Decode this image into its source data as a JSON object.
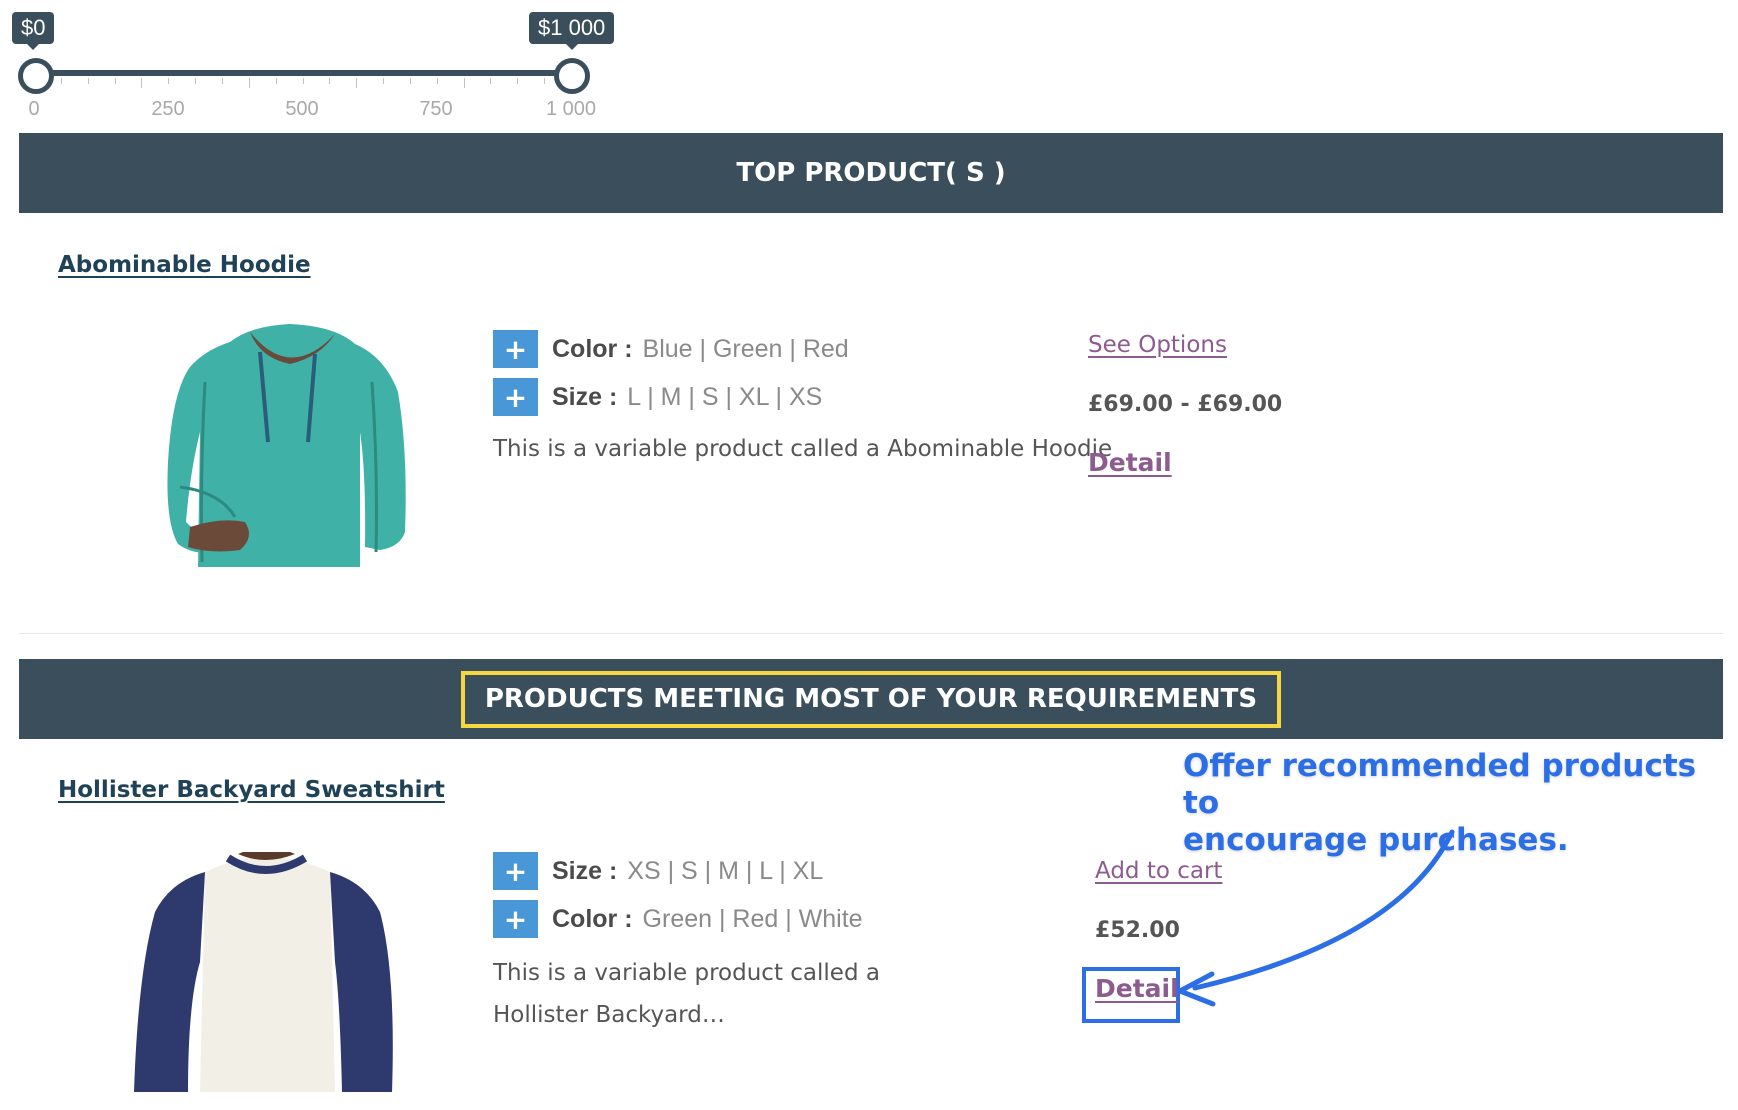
{
  "price_filter": {
    "min_label": "$0",
    "max_label": "$1 000",
    "selected_min": 0,
    "selected_max": 1000,
    "range_min": 0,
    "range_max": 1000,
    "tick_labels": [
      "0",
      "250",
      "500",
      "750",
      "1 000"
    ]
  },
  "sections": {
    "top_products_title": "TOP PRODUCT( S )",
    "recommended_title": "PRODUCTS MEETING MOST OF YOUR REQUIREMENTS"
  },
  "products": [
    {
      "name": "Abominable Hoodie",
      "attributes": [
        {
          "label": "Color :",
          "values": "Blue | Green | Red"
        },
        {
          "label": "Size :",
          "values": "L | M | S | XL | XS"
        }
      ],
      "description": "This is a variable product called a Abominable Hoodie",
      "action_label": "See Options",
      "price": "£69.00 - £69.00",
      "detail_label": "Detail"
    },
    {
      "name": "Hollister Backyard Sweatshirt",
      "attributes": [
        {
          "label": "Size :",
          "values": "XS | S | M | L | XL"
        },
        {
          "label": "Color :",
          "values": "Green | Red | White"
        }
      ],
      "description_line1": "This is a variable product called a",
      "description_line2": "Hollister Backyard…",
      "action_label": "Add to cart",
      "price": "£52.00",
      "detail_label": "Detail"
    }
  ],
  "annotation": {
    "line1": "Offer recommended products to",
    "line2": "encourage purchases.",
    "color": "#2c6ee6"
  },
  "colors": {
    "header_bg": "#3a4f5b",
    "plus_button": "#4a97d8",
    "link_purple": "#8c5b8f",
    "title_link": "#1f4257",
    "highlight_yellow": "#f5d742"
  },
  "icons": {
    "expand": "plus-icon",
    "handle": "slider-handle"
  }
}
